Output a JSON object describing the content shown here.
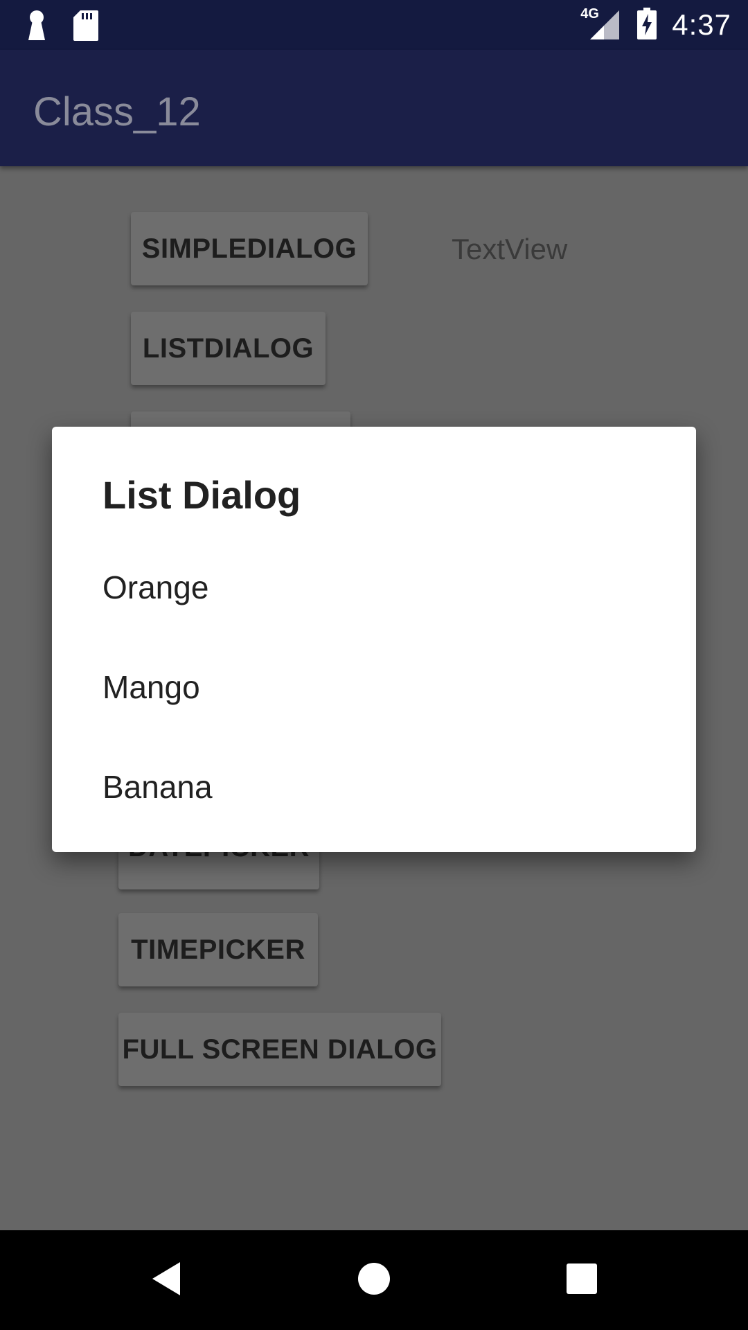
{
  "status_bar": {
    "time": "4:37",
    "network_label": "4G",
    "icons": [
      "keyhole-icon",
      "sd-card-icon",
      "signal-icon",
      "battery-charging-icon"
    ]
  },
  "app_bar": {
    "title": "Class_12"
  },
  "buttons": {
    "simple_dialog": "SIMPLEDIALOG",
    "list_dialog": "LISTDIALOG",
    "date_picker": "DATEPICKER",
    "time_picker": "TIMEPICKER",
    "full_screen_dialog": "FULL SCREEN DIALOG"
  },
  "textview": "TextView",
  "dialog": {
    "title": "List Dialog",
    "items": [
      "Orange",
      "Mango",
      "Banana"
    ]
  },
  "nav_bar": {
    "icons": [
      "back-icon",
      "home-icon",
      "recents-icon"
    ]
  },
  "colors": {
    "status_bar": "#141a40",
    "app_bar": "#1b1f48",
    "scrim_background": "#666666",
    "dialog_background": "#ffffff"
  }
}
